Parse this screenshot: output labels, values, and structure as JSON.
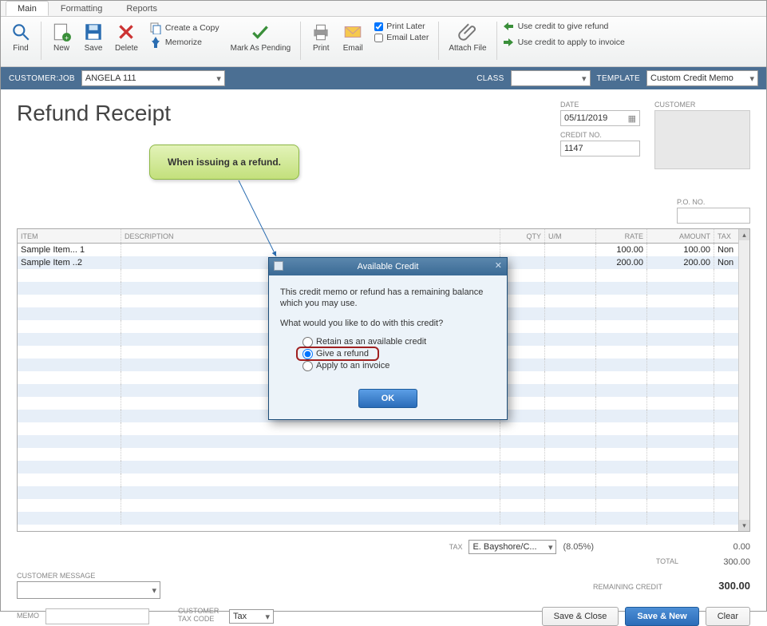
{
  "tabs": {
    "main": "Main",
    "formatting": "Formatting",
    "reports": "Reports"
  },
  "toolbar": {
    "find": "Find",
    "new": "New",
    "save": "Save",
    "delete": "Delete",
    "create_copy": "Create a Copy",
    "memorize": "Memorize",
    "mark_pending": "Mark As Pending",
    "print": "Print",
    "email": "Email",
    "print_later": "Print Later",
    "email_later": "Email Later",
    "attach_file": "Attach File",
    "use_credit_refund": "Use credit to give refund",
    "use_credit_invoice": "Use credit to apply to invoice"
  },
  "header": {
    "customer_job_label": "CUSTOMER:JOB",
    "customer_job_value": "ANGELA 111",
    "class_label": "CLASS",
    "class_value": "",
    "template_label": "TEMPLATE",
    "template_value": "Custom Credit Memo"
  },
  "form": {
    "title": "Refund Receipt",
    "date_label": "DATE",
    "date_value": "05/11/2019",
    "credit_no_label": "CREDIT NO.",
    "credit_no_value": "1147",
    "customer_label": "CUSTOMER",
    "po_label": "P.O. NO.",
    "po_value": ""
  },
  "table": {
    "headers": {
      "item": "ITEM",
      "desc": "DESCRIPTION",
      "qty": "QTY",
      "um": "U/M",
      "rate": "RATE",
      "amount": "AMOUNT",
      "tax": "TAX"
    },
    "rows": [
      {
        "item": "Sample Item... 1",
        "desc": "",
        "qty": "",
        "um": "",
        "rate": "100.00",
        "amount": "100.00",
        "tax": "Non"
      },
      {
        "item": "Sample Item ..2",
        "desc": "",
        "qty": "",
        "um": "",
        "rate": "200.00",
        "amount": "200.00",
        "tax": "Non"
      }
    ]
  },
  "footer": {
    "tax_label": "TAX",
    "tax_code": "E. Bayshore/C...",
    "tax_pct": "(8.05%)",
    "tax_amount": "0.00",
    "total_label": "TOTAL",
    "total_amount": "300.00",
    "cust_msg_label": "CUSTOMER MESSAGE",
    "cust_msg": "",
    "remaining_label": "REMAINING CREDIT",
    "remaining_amount": "300.00",
    "memo_label": "MEMO",
    "memo_value": "",
    "cust_tax_label": "CUSTOMER TAX CODE",
    "cust_tax_value": "Tax",
    "save_close": "Save & Close",
    "save_new": "Save & New",
    "clear": "Clear"
  },
  "callout": {
    "text": "When issuing a a refund."
  },
  "dialog": {
    "title": "Available Credit",
    "line1": "This credit memo or refund has a remaining balance which you may use.",
    "line2": "What would you like to do with this credit?",
    "opt1": "Retain as an available credit",
    "opt2": "Give a refund",
    "opt3": "Apply to an invoice",
    "ok": "OK"
  }
}
